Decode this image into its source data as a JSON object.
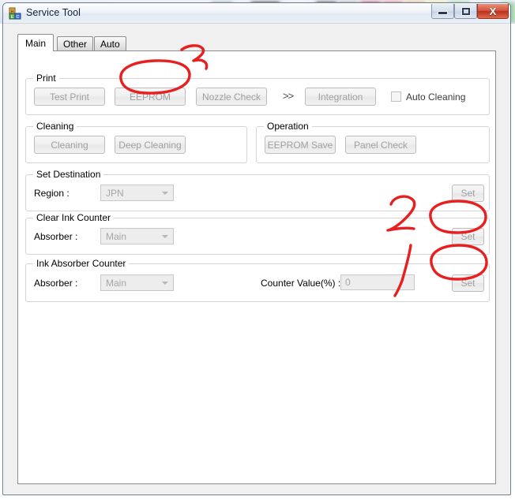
{
  "window": {
    "title": "Service Tool",
    "icon": "app-blocks-icon",
    "controls": {
      "minimize": "minimize-icon",
      "maximize": "maximize-icon",
      "close": "X"
    }
  },
  "background": {
    "swatch_colors": [
      "#8f9aa6",
      "#7f8b98",
      "#1a1a1a",
      "#f8f8f8",
      "#1c1c1c",
      "#8c8c8c",
      "#9e1230",
      "#e03d3d",
      "#f0983f",
      "#f5ea62",
      "#7ec87e",
      "#9fd4a6"
    ]
  },
  "tabs": [
    {
      "label": "Main",
      "selected": true
    },
    {
      "label": "Other",
      "selected": false
    },
    {
      "label": "Auto",
      "selected": false
    }
  ],
  "groups": {
    "print": {
      "title": "Print",
      "buttons": [
        {
          "label": "Test Print"
        },
        {
          "label": "EEPROM"
        },
        {
          "label": "Nozzle Check"
        },
        {
          "label": "Integration"
        }
      ],
      "separator": ">>",
      "checkbox": {
        "label": "Auto Cleaning",
        "checked": false
      }
    },
    "cleaning": {
      "title": "Cleaning",
      "buttons": [
        {
          "label": "Cleaning"
        },
        {
          "label": "Deep Cleaning"
        }
      ]
    },
    "operation": {
      "title": "Operation",
      "buttons": [
        {
          "label": "EEPROM Save"
        },
        {
          "label": "Panel Check"
        }
      ]
    },
    "set_destination": {
      "title": "Set Destination",
      "region_label": "Region :",
      "region_value": "JPN",
      "set_label": "Set"
    },
    "clear_ink_counter": {
      "title": "Clear Ink Counter",
      "absorber_label": "Absorber :",
      "absorber_value": "Main",
      "set_label": "Set"
    },
    "ink_absorber_counter": {
      "title": "Ink Absorber Counter",
      "absorber_label": "Absorber :",
      "absorber_value": "Main",
      "counter_label": "Counter Value(%) :",
      "counter_value": "0",
      "set_label": "Set"
    }
  },
  "annotations": {
    "color": "#e81f1f",
    "marks": [
      {
        "name": "annotation-number-3",
        "text": "3"
      },
      {
        "name": "annotation-number-2",
        "text": "2"
      },
      {
        "name": "annotation-number-1",
        "text": "1"
      }
    ]
  }
}
